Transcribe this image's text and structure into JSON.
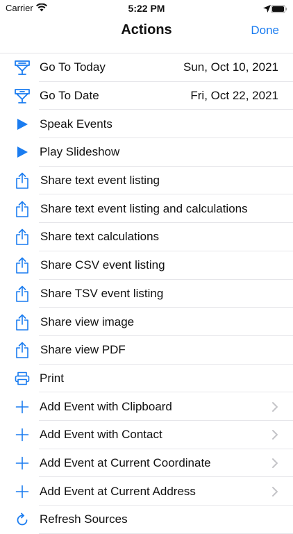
{
  "status_bar": {
    "carrier": "Carrier",
    "time": "5:22 PM"
  },
  "nav": {
    "title": "Actions",
    "done_label": "Done"
  },
  "accent_color": "#1a7cf0",
  "rows": [
    {
      "label": "Go To Today",
      "value": "Sun, Oct 10, 2021",
      "icon": "calendar-today-icon"
    },
    {
      "label": "Go To Date",
      "value": "Fri, Oct 22, 2021",
      "icon": "calendar-date-icon"
    },
    {
      "label": "Speak Events",
      "icon": "play-icon"
    },
    {
      "label": "Play Slideshow",
      "icon": "play-icon"
    },
    {
      "label": "Share text event listing",
      "icon": "share-icon"
    },
    {
      "label": "Share text event listing and calculations",
      "icon": "share-icon"
    },
    {
      "label": "Share text calculations",
      "icon": "share-icon"
    },
    {
      "label": "Share CSV event listing",
      "icon": "share-icon"
    },
    {
      "label": "Share TSV event listing",
      "icon": "share-icon"
    },
    {
      "label": "Share view image",
      "icon": "share-icon"
    },
    {
      "label": "Share view PDF",
      "icon": "share-icon"
    },
    {
      "label": "Print",
      "icon": "printer-icon"
    },
    {
      "label": "Add Event with Clipboard",
      "icon": "plus-icon",
      "chevron": true
    },
    {
      "label": "Add Event with Contact",
      "icon": "plus-icon",
      "chevron": true
    },
    {
      "label": "Add Event at Current Coordinate",
      "icon": "plus-icon",
      "chevron": true
    },
    {
      "label": "Add Event at Current Address",
      "icon": "plus-icon",
      "chevron": true
    },
    {
      "label": "Refresh Sources",
      "icon": "refresh-icon"
    }
  ]
}
